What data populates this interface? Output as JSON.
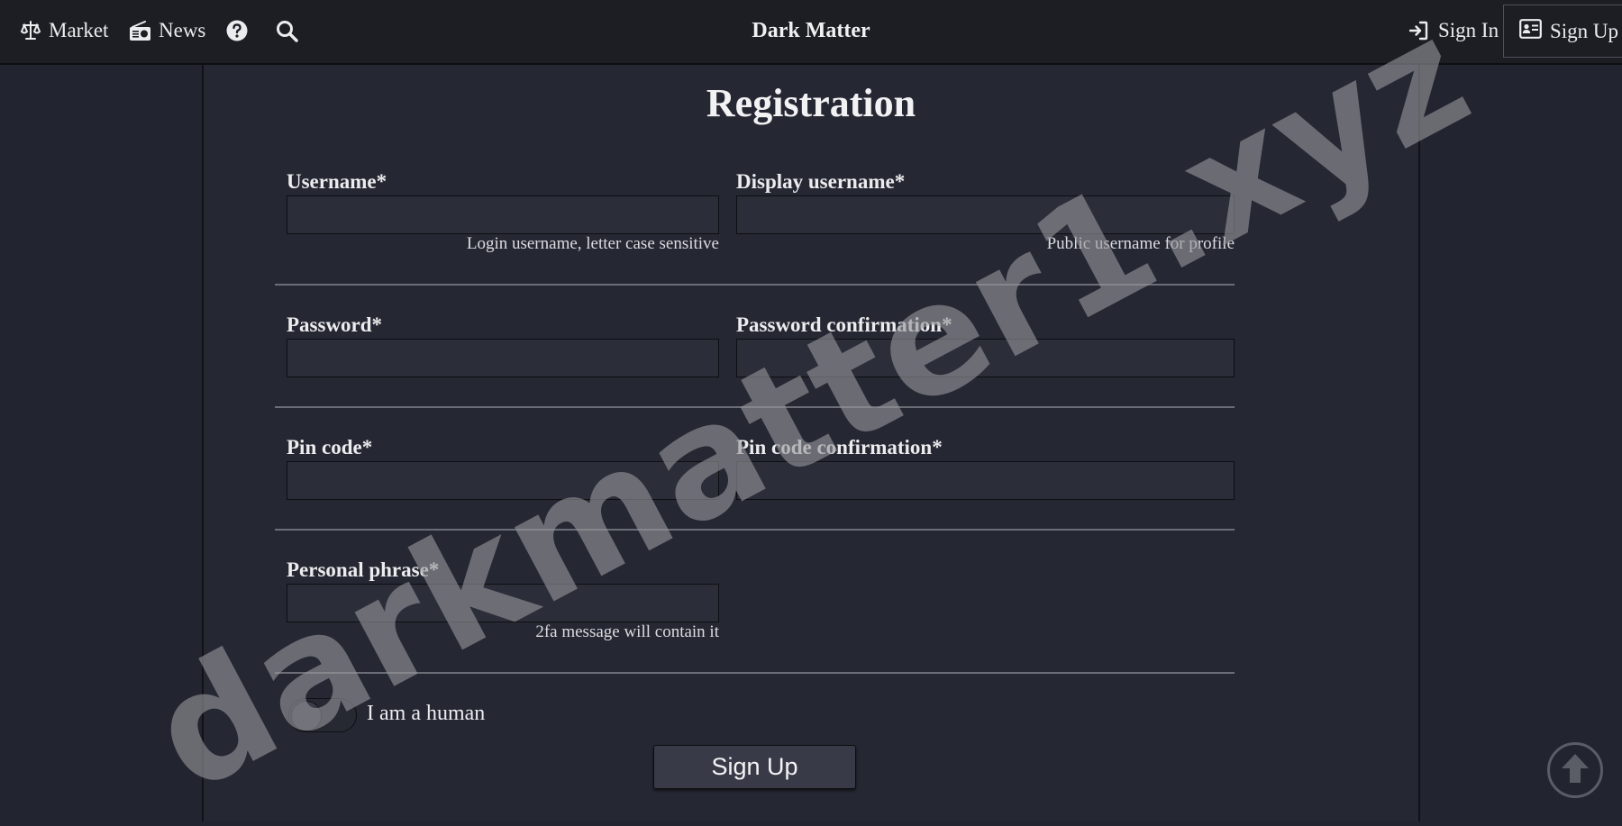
{
  "nav": {
    "market_label": "Market",
    "news_label": "News",
    "brand": "Dark Matter",
    "signin_label": "Sign In",
    "signup_label": "Sign Up",
    "icons": {
      "market": "scale-icon",
      "news": "radio-icon",
      "help": "question-circle-icon",
      "search": "search-icon",
      "signin": "sign-in-icon",
      "signup": "id-card-icon"
    }
  },
  "form": {
    "title": "Registration",
    "username": {
      "label": "Username*",
      "value": "",
      "hint": "Login username, letter case sensitive"
    },
    "display_username": {
      "label": "Display username*",
      "value": "",
      "hint": "Public username for profile"
    },
    "password": {
      "label": "Password*",
      "value": ""
    },
    "password_confirmation": {
      "label": "Password confirmation*",
      "value": ""
    },
    "pin_code": {
      "label": "Pin code*",
      "value": ""
    },
    "pin_code_confirmation": {
      "label": "Pin code confirmation*",
      "value": ""
    },
    "personal_phrase": {
      "label": "Personal phrase*",
      "value": "",
      "hint": "2fa message will contain it"
    },
    "human_toggle": {
      "label": "I am a human",
      "checked": false
    },
    "submit_label": "Sign Up"
  },
  "watermark": "darkmatter1.xyz",
  "colors": {
    "background": "#22252f",
    "panel": "#252833",
    "navbar": "#1c1e24",
    "input": "#2b2e39",
    "button": "#383b47"
  }
}
